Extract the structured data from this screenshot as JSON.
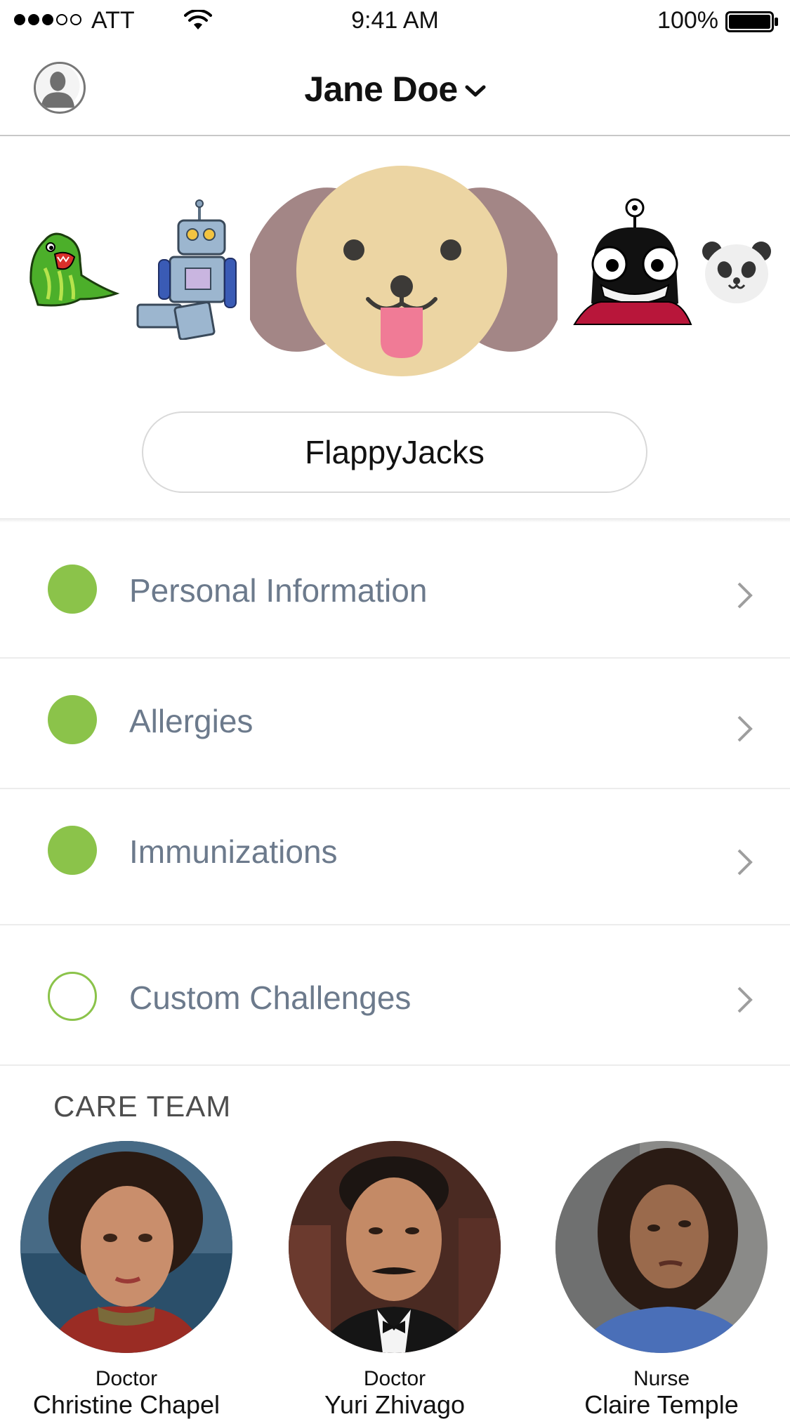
{
  "status_bar": {
    "carrier": "ATT",
    "time": "9:41 AM",
    "battery": "100%",
    "signal_bars_filled": 3,
    "signal_bars_total": 5
  },
  "header": {
    "title": "Jane Doe",
    "profile_icon": "user-silhouette-icon",
    "dropdown_icon": "chevron-down-icon"
  },
  "characters": [
    "green-dinosaur",
    "robot",
    "dog",
    "one-eyed-alien",
    "panda"
  ],
  "selected_character": "dog",
  "username": {
    "value": "FlappyJacks"
  },
  "checklist": [
    {
      "label": "Personal Information",
      "complete": true
    },
    {
      "label": "Allergies",
      "complete": true
    },
    {
      "label": "Immunizations",
      "complete": true
    },
    {
      "label": "Custom Challenges",
      "complete": false
    }
  ],
  "care_team": {
    "heading": "CARE TEAM",
    "members": [
      {
        "role": "Doctor",
        "name": "Christine Chapel"
      },
      {
        "role": "Doctor",
        "name": "Yuri Zhivago"
      },
      {
        "role": "Nurse",
        "name": "Claire Temple"
      }
    ]
  },
  "colors": {
    "accent_green": "#8bc34a",
    "label_gray": "#6c7a8c",
    "dog_face": "#ecd5a3",
    "dog_ears": "#a38686",
    "dog_tongue": "#f07b96"
  }
}
